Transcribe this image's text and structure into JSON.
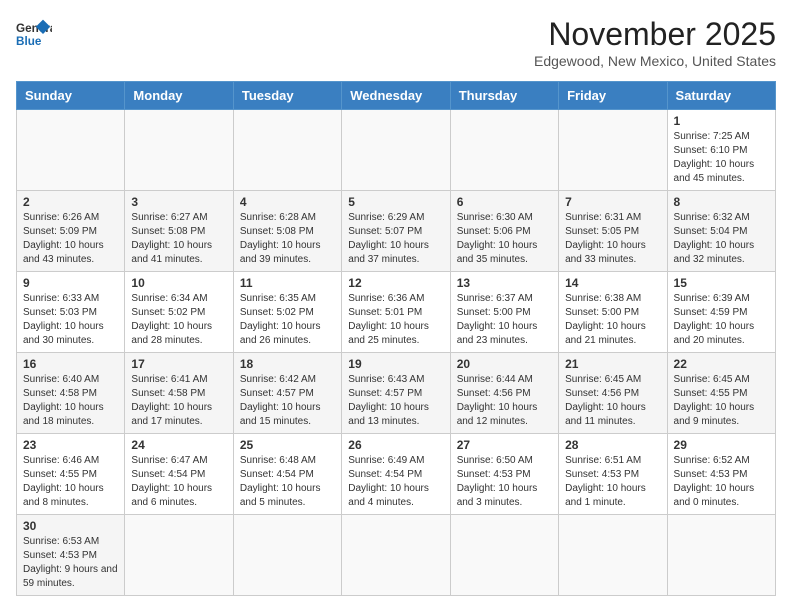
{
  "logo": {
    "line1": "General",
    "line2": "Blue"
  },
  "title": "November 2025",
  "subtitle": "Edgewood, New Mexico, United States",
  "weekdays": [
    "Sunday",
    "Monday",
    "Tuesday",
    "Wednesday",
    "Thursday",
    "Friday",
    "Saturday"
  ],
  "weeks": [
    [
      {
        "day": "",
        "info": ""
      },
      {
        "day": "",
        "info": ""
      },
      {
        "day": "",
        "info": ""
      },
      {
        "day": "",
        "info": ""
      },
      {
        "day": "",
        "info": ""
      },
      {
        "day": "",
        "info": ""
      },
      {
        "day": "1",
        "info": "Sunrise: 7:25 AM\nSunset: 6:10 PM\nDaylight: 10 hours and 45 minutes."
      }
    ],
    [
      {
        "day": "2",
        "info": "Sunrise: 6:26 AM\nSunset: 5:09 PM\nDaylight: 10 hours and 43 minutes."
      },
      {
        "day": "3",
        "info": "Sunrise: 6:27 AM\nSunset: 5:08 PM\nDaylight: 10 hours and 41 minutes."
      },
      {
        "day": "4",
        "info": "Sunrise: 6:28 AM\nSunset: 5:08 PM\nDaylight: 10 hours and 39 minutes."
      },
      {
        "day": "5",
        "info": "Sunrise: 6:29 AM\nSunset: 5:07 PM\nDaylight: 10 hours and 37 minutes."
      },
      {
        "day": "6",
        "info": "Sunrise: 6:30 AM\nSunset: 5:06 PM\nDaylight: 10 hours and 35 minutes."
      },
      {
        "day": "7",
        "info": "Sunrise: 6:31 AM\nSunset: 5:05 PM\nDaylight: 10 hours and 33 minutes."
      },
      {
        "day": "8",
        "info": "Sunrise: 6:32 AM\nSunset: 5:04 PM\nDaylight: 10 hours and 32 minutes."
      }
    ],
    [
      {
        "day": "9",
        "info": "Sunrise: 6:33 AM\nSunset: 5:03 PM\nDaylight: 10 hours and 30 minutes."
      },
      {
        "day": "10",
        "info": "Sunrise: 6:34 AM\nSunset: 5:02 PM\nDaylight: 10 hours and 28 minutes."
      },
      {
        "day": "11",
        "info": "Sunrise: 6:35 AM\nSunset: 5:02 PM\nDaylight: 10 hours and 26 minutes."
      },
      {
        "day": "12",
        "info": "Sunrise: 6:36 AM\nSunset: 5:01 PM\nDaylight: 10 hours and 25 minutes."
      },
      {
        "day": "13",
        "info": "Sunrise: 6:37 AM\nSunset: 5:00 PM\nDaylight: 10 hours and 23 minutes."
      },
      {
        "day": "14",
        "info": "Sunrise: 6:38 AM\nSunset: 5:00 PM\nDaylight: 10 hours and 21 minutes."
      },
      {
        "day": "15",
        "info": "Sunrise: 6:39 AM\nSunset: 4:59 PM\nDaylight: 10 hours and 20 minutes."
      }
    ],
    [
      {
        "day": "16",
        "info": "Sunrise: 6:40 AM\nSunset: 4:58 PM\nDaylight: 10 hours and 18 minutes."
      },
      {
        "day": "17",
        "info": "Sunrise: 6:41 AM\nSunset: 4:58 PM\nDaylight: 10 hours and 17 minutes."
      },
      {
        "day": "18",
        "info": "Sunrise: 6:42 AM\nSunset: 4:57 PM\nDaylight: 10 hours and 15 minutes."
      },
      {
        "day": "19",
        "info": "Sunrise: 6:43 AM\nSunset: 4:57 PM\nDaylight: 10 hours and 13 minutes."
      },
      {
        "day": "20",
        "info": "Sunrise: 6:44 AM\nSunset: 4:56 PM\nDaylight: 10 hours and 12 minutes."
      },
      {
        "day": "21",
        "info": "Sunrise: 6:45 AM\nSunset: 4:56 PM\nDaylight: 10 hours and 11 minutes."
      },
      {
        "day": "22",
        "info": "Sunrise: 6:45 AM\nSunset: 4:55 PM\nDaylight: 10 hours and 9 minutes."
      }
    ],
    [
      {
        "day": "23",
        "info": "Sunrise: 6:46 AM\nSunset: 4:55 PM\nDaylight: 10 hours and 8 minutes."
      },
      {
        "day": "24",
        "info": "Sunrise: 6:47 AM\nSunset: 4:54 PM\nDaylight: 10 hours and 6 minutes."
      },
      {
        "day": "25",
        "info": "Sunrise: 6:48 AM\nSunset: 4:54 PM\nDaylight: 10 hours and 5 minutes."
      },
      {
        "day": "26",
        "info": "Sunrise: 6:49 AM\nSunset: 4:54 PM\nDaylight: 10 hours and 4 minutes."
      },
      {
        "day": "27",
        "info": "Sunrise: 6:50 AM\nSunset: 4:53 PM\nDaylight: 10 hours and 3 minutes."
      },
      {
        "day": "28",
        "info": "Sunrise: 6:51 AM\nSunset: 4:53 PM\nDaylight: 10 hours and 1 minute."
      },
      {
        "day": "29",
        "info": "Sunrise: 6:52 AM\nSunset: 4:53 PM\nDaylight: 10 hours and 0 minutes."
      }
    ],
    [
      {
        "day": "30",
        "info": "Sunrise: 6:53 AM\nSunset: 4:53 PM\nDaylight: 9 hours and 59 minutes."
      },
      {
        "day": "",
        "info": ""
      },
      {
        "day": "",
        "info": ""
      },
      {
        "day": "",
        "info": ""
      },
      {
        "day": "",
        "info": ""
      },
      {
        "day": "",
        "info": ""
      },
      {
        "day": "",
        "info": ""
      }
    ]
  ]
}
